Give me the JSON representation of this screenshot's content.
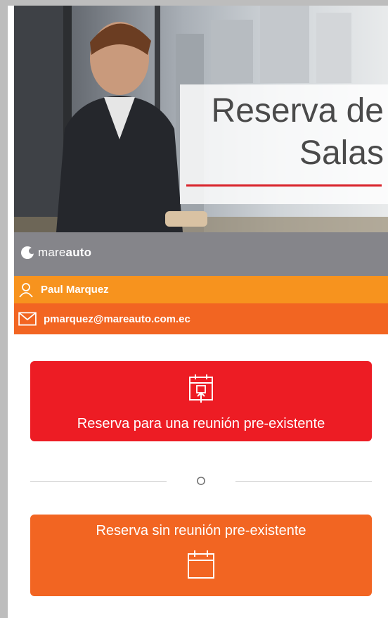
{
  "hero": {
    "title_line1": "Reserva de",
    "title_line2": "Salas",
    "accent_line_color": "#d9232b"
  },
  "brand": {
    "logo_part1": "mare",
    "logo_part2": "auto",
    "logo_icon": "mareauto-logo-icon"
  },
  "user": {
    "name": "Paul Marquez",
    "name_icon": "person-icon",
    "email": "pmarquez@mareauto.com.ec",
    "email_icon": "envelope-icon"
  },
  "actions": {
    "existing_meeting_label": "Reserva para una reunión pre-existente",
    "existing_meeting_icon": "calendar-upload-icon",
    "separator_label": "O",
    "no_meeting_label": "Reserva sin reunión pre-existente",
    "no_meeting_icon": "calendar-icon"
  },
  "colors": {
    "brand_gray": "#85858a",
    "name_bar": "#f7931e",
    "email_bar": "#f26522",
    "primary_red": "#ed1c24",
    "secondary_orange": "#f26522"
  }
}
